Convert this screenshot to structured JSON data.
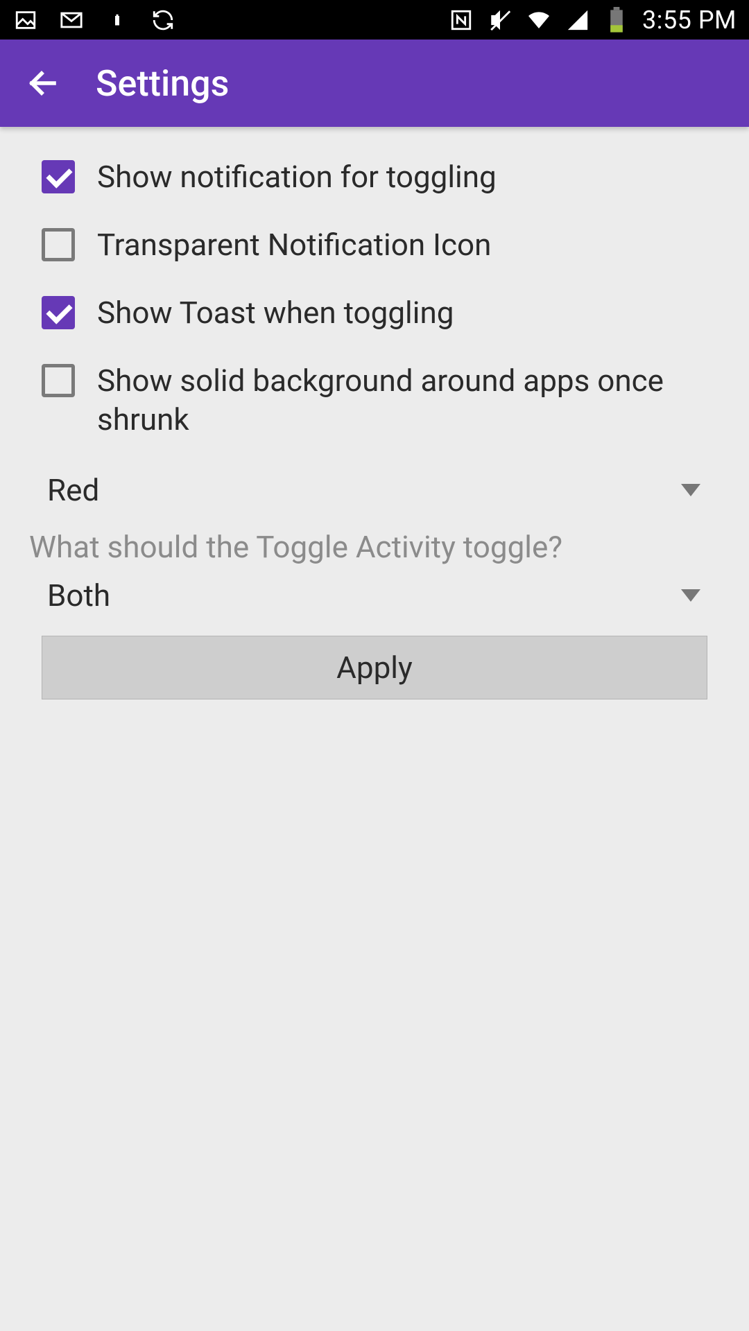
{
  "status_bar": {
    "icons_left": [
      "image-icon",
      "mail-icon",
      "battery-low-icon",
      "sync-icon"
    ],
    "icons_right": [
      "nfc-icon",
      "mute-icon",
      "wifi-icon",
      "signal-icon",
      "battery-icon"
    ],
    "time": "3:55 PM"
  },
  "app_bar": {
    "title": "Settings"
  },
  "checkboxes": [
    {
      "checked": true,
      "label": "Show notification for toggling"
    },
    {
      "checked": false,
      "label": "Transparent Notification Icon"
    },
    {
      "checked": true,
      "label": "Show Toast when toggling"
    },
    {
      "checked": false,
      "label": "Show solid background around apps once shrunk"
    }
  ],
  "color_dropdown": {
    "value": "Red"
  },
  "question_label": "What should the Toggle Activity toggle?",
  "activity_dropdown": {
    "value": "Both"
  },
  "apply_button": {
    "label": "Apply"
  },
  "accent_color": "#6639b6"
}
